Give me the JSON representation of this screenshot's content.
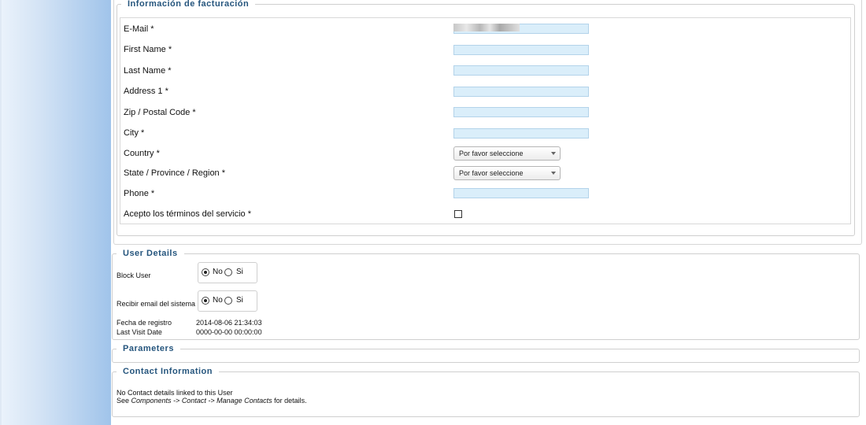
{
  "billing": {
    "legend": "Información de facturación",
    "fields": [
      {
        "label": "E-Mail *"
      },
      {
        "label": "First Name *"
      },
      {
        "label": "Last Name *"
      },
      {
        "label": "Address 1 *"
      },
      {
        "label": "Zip / Postal Code *"
      },
      {
        "label": "City *"
      },
      {
        "label": "Country *",
        "select_value": "Por favor seleccione"
      },
      {
        "label": "State / Province / Region *",
        "select_value": "Por favor seleccione"
      },
      {
        "label": "Phone *"
      },
      {
        "label": "Acepto los términos del servicio *"
      }
    ]
  },
  "user_details": {
    "legend": "User Details",
    "block_user": {
      "label": "Block User",
      "opt_no": "No",
      "opt_si": "Si"
    },
    "recibir_email": {
      "label": "Recibir email del sistema",
      "opt_no": "No",
      "opt_si": "Si"
    },
    "fecha_registro": {
      "label": "Fecha de registro",
      "value": "2014-08-06 21:34:03"
    },
    "last_visit": {
      "label": "Last Visit Date",
      "value": "0000-00-00 00:00:00"
    }
  },
  "parameters": {
    "legend": "Parameters"
  },
  "contact": {
    "legend": "Contact Information",
    "line1": "No Contact details linked to this User",
    "line2_pre": "See ",
    "line2_path1": "Components",
    "line2_sep1": " -> ",
    "line2_path2": "Contact",
    "line2_sep2": " -> ",
    "line2_path3": "Manage Contacts",
    "line2_post": " for details."
  }
}
